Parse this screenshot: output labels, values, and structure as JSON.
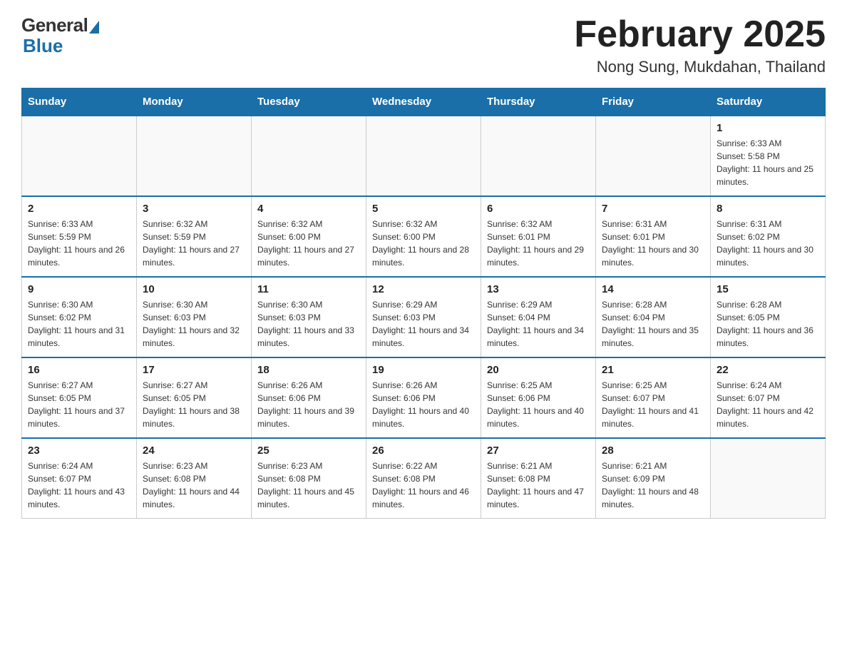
{
  "logo": {
    "general": "General",
    "blue": "Blue"
  },
  "header": {
    "month": "February 2025",
    "location": "Nong Sung, Mukdahan, Thailand"
  },
  "days": [
    "Sunday",
    "Monday",
    "Tuesday",
    "Wednesday",
    "Thursday",
    "Friday",
    "Saturday"
  ],
  "weeks": [
    [
      {
        "day": "",
        "info": ""
      },
      {
        "day": "",
        "info": ""
      },
      {
        "day": "",
        "info": ""
      },
      {
        "day": "",
        "info": ""
      },
      {
        "day": "",
        "info": ""
      },
      {
        "day": "",
        "info": ""
      },
      {
        "day": "1",
        "info": "Sunrise: 6:33 AM\nSunset: 5:58 PM\nDaylight: 11 hours and 25 minutes."
      }
    ],
    [
      {
        "day": "2",
        "info": "Sunrise: 6:33 AM\nSunset: 5:59 PM\nDaylight: 11 hours and 26 minutes."
      },
      {
        "day": "3",
        "info": "Sunrise: 6:32 AM\nSunset: 5:59 PM\nDaylight: 11 hours and 27 minutes."
      },
      {
        "day": "4",
        "info": "Sunrise: 6:32 AM\nSunset: 6:00 PM\nDaylight: 11 hours and 27 minutes."
      },
      {
        "day": "5",
        "info": "Sunrise: 6:32 AM\nSunset: 6:00 PM\nDaylight: 11 hours and 28 minutes."
      },
      {
        "day": "6",
        "info": "Sunrise: 6:32 AM\nSunset: 6:01 PM\nDaylight: 11 hours and 29 minutes."
      },
      {
        "day": "7",
        "info": "Sunrise: 6:31 AM\nSunset: 6:01 PM\nDaylight: 11 hours and 30 minutes."
      },
      {
        "day": "8",
        "info": "Sunrise: 6:31 AM\nSunset: 6:02 PM\nDaylight: 11 hours and 30 minutes."
      }
    ],
    [
      {
        "day": "9",
        "info": "Sunrise: 6:30 AM\nSunset: 6:02 PM\nDaylight: 11 hours and 31 minutes."
      },
      {
        "day": "10",
        "info": "Sunrise: 6:30 AM\nSunset: 6:03 PM\nDaylight: 11 hours and 32 minutes."
      },
      {
        "day": "11",
        "info": "Sunrise: 6:30 AM\nSunset: 6:03 PM\nDaylight: 11 hours and 33 minutes."
      },
      {
        "day": "12",
        "info": "Sunrise: 6:29 AM\nSunset: 6:03 PM\nDaylight: 11 hours and 34 minutes."
      },
      {
        "day": "13",
        "info": "Sunrise: 6:29 AM\nSunset: 6:04 PM\nDaylight: 11 hours and 34 minutes."
      },
      {
        "day": "14",
        "info": "Sunrise: 6:28 AM\nSunset: 6:04 PM\nDaylight: 11 hours and 35 minutes."
      },
      {
        "day": "15",
        "info": "Sunrise: 6:28 AM\nSunset: 6:05 PM\nDaylight: 11 hours and 36 minutes."
      }
    ],
    [
      {
        "day": "16",
        "info": "Sunrise: 6:27 AM\nSunset: 6:05 PM\nDaylight: 11 hours and 37 minutes."
      },
      {
        "day": "17",
        "info": "Sunrise: 6:27 AM\nSunset: 6:05 PM\nDaylight: 11 hours and 38 minutes."
      },
      {
        "day": "18",
        "info": "Sunrise: 6:26 AM\nSunset: 6:06 PM\nDaylight: 11 hours and 39 minutes."
      },
      {
        "day": "19",
        "info": "Sunrise: 6:26 AM\nSunset: 6:06 PM\nDaylight: 11 hours and 40 minutes."
      },
      {
        "day": "20",
        "info": "Sunrise: 6:25 AM\nSunset: 6:06 PM\nDaylight: 11 hours and 40 minutes."
      },
      {
        "day": "21",
        "info": "Sunrise: 6:25 AM\nSunset: 6:07 PM\nDaylight: 11 hours and 41 minutes."
      },
      {
        "day": "22",
        "info": "Sunrise: 6:24 AM\nSunset: 6:07 PM\nDaylight: 11 hours and 42 minutes."
      }
    ],
    [
      {
        "day": "23",
        "info": "Sunrise: 6:24 AM\nSunset: 6:07 PM\nDaylight: 11 hours and 43 minutes."
      },
      {
        "day": "24",
        "info": "Sunrise: 6:23 AM\nSunset: 6:08 PM\nDaylight: 11 hours and 44 minutes."
      },
      {
        "day": "25",
        "info": "Sunrise: 6:23 AM\nSunset: 6:08 PM\nDaylight: 11 hours and 45 minutes."
      },
      {
        "day": "26",
        "info": "Sunrise: 6:22 AM\nSunset: 6:08 PM\nDaylight: 11 hours and 46 minutes."
      },
      {
        "day": "27",
        "info": "Sunrise: 6:21 AM\nSunset: 6:08 PM\nDaylight: 11 hours and 47 minutes."
      },
      {
        "day": "28",
        "info": "Sunrise: 6:21 AM\nSunset: 6:09 PM\nDaylight: 11 hours and 48 minutes."
      },
      {
        "day": "",
        "info": ""
      }
    ]
  ]
}
